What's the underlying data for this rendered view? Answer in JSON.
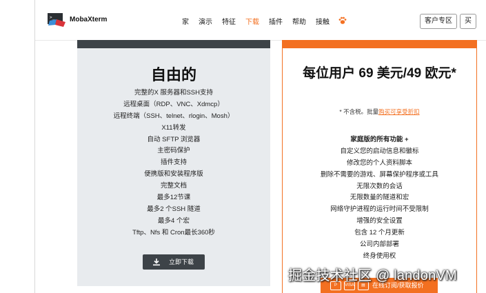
{
  "nav": {
    "logo_text": "MobaXterm",
    "items": [
      "家",
      "演示",
      "特征",
      "下载",
      "插件",
      "帮助",
      "接触"
    ],
    "active_item": "下载",
    "client_button": "客户专区",
    "buy_button": "买"
  },
  "free_card": {
    "title": "自由的",
    "features": [
      "完整的X 服务器和SSH支持",
      "远程桌面（RDP、VNC、Xdmcp）",
      "远程终端（SSH、telnet、rlogin、Mosh）",
      "X11转发",
      "自动 SFTP 浏览器",
      "主密码保护",
      "插件支持",
      "便携版和安装程序版",
      "完整文档",
      "最多12节课",
      "最多2 个SSH 隧道",
      "最多4 个宏",
      "Tftp、Nfs 和 Cron最长360秒"
    ],
    "download_button": "立即下载"
  },
  "pro_card": {
    "title": "每位用户 69 美元/49 欧元*",
    "note_prefix": "* 不含税。批量",
    "note_link": "购买可享受折扣",
    "features": [
      "家庭版的所有功能 +",
      "自定义您的启动信息和徽标",
      "修改您的个人资料脚本",
      "删除不需要的游戏、屏幕保护程序或工具",
      "无限次数的会话",
      "无限数量的隧道和宏",
      "网络守护进程的运行时间不受限制",
      "增强的安全设置",
      "包含 12 个月更新",
      "公司内部部署",
      "终身使用权"
    ],
    "buy_label": "在线订阅/获取报价",
    "pay_icons": [
      "P",
      "VISA",
      "▤"
    ]
  },
  "watermark": "掘金技术社区 @ landonVM",
  "colors": {
    "accent": "#f37021",
    "dark": "#3d4348",
    "free_bg": "#e8ebee"
  }
}
